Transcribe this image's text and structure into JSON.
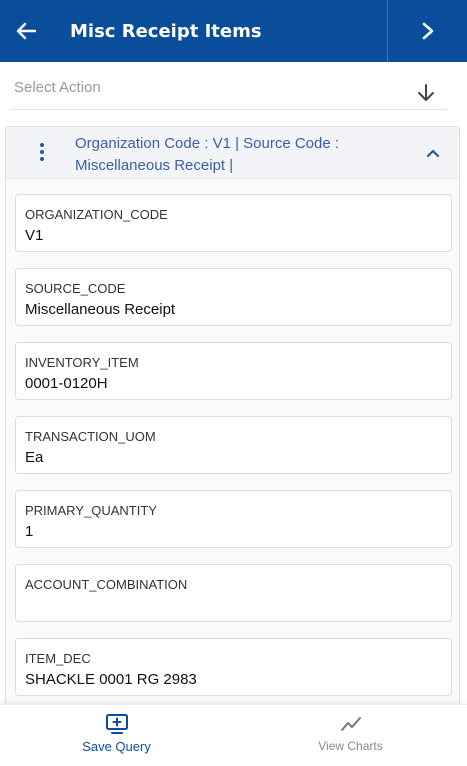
{
  "header": {
    "title": "Misc Receipt Items",
    "back_icon": "arrow-left-icon",
    "next_icon": "chevron-right-icon",
    "background": "#0a4e9b"
  },
  "action_bar": {
    "placeholder": "Select Action",
    "icon": "arrow-down-icon"
  },
  "group": {
    "title": "Organization Code : V1 | Source Code : Miscellaneous Receipt |",
    "menu_icon": "kebab-menu-icon",
    "toggle_icon": "chevron-up-icon"
  },
  "fields": [
    {
      "label": "ORGANIZATION_CODE",
      "value": "V1"
    },
    {
      "label": "SOURCE_CODE",
      "value": "Miscellaneous Receipt"
    },
    {
      "label": "INVENTORY_ITEM",
      "value": "0001-0120H"
    },
    {
      "label": "TRANSACTION_UOM",
      "value": "Ea"
    },
    {
      "label": "PRIMARY_QUANTITY",
      "value": "1"
    },
    {
      "label": "ACCOUNT_COMBINATION",
      "value": ""
    },
    {
      "label": "ITEM_DEC",
      "value": "SHACKLE 0001 RG 2983"
    }
  ],
  "bottom_nav": {
    "save_query": {
      "label": "Save Query",
      "icon": "save-query-icon",
      "color": "#0a4e9b"
    },
    "view_charts": {
      "label": "View Charts",
      "icon": "line-chart-icon",
      "color": "#8a8a8a"
    }
  }
}
